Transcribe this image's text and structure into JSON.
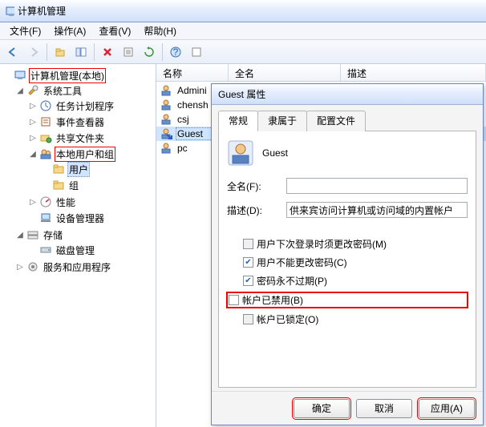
{
  "window": {
    "title": "计算机管理"
  },
  "menus": {
    "file": "文件(F)",
    "action": "操作(A)",
    "view": "查看(V)",
    "help": "帮助(H)"
  },
  "tree": {
    "root": "计算机管理(本地)",
    "sys_tools": "系统工具",
    "task_sched": "任务计划程序",
    "event_viewer": "事件查看器",
    "shared": "共享文件夹",
    "local_ug": "本地用户和组",
    "users": "用户",
    "groups": "组",
    "perf": "性能",
    "devmgr": "设备管理器",
    "storage": "存储",
    "diskmgmt": "磁盘管理",
    "services": "服务和应用程序"
  },
  "list": {
    "headers": {
      "name": "名称",
      "fullname": "全名",
      "desc": "描述"
    },
    "rows": [
      {
        "name": "Admini"
      },
      {
        "name": "chensh"
      },
      {
        "name": "csj"
      },
      {
        "name": "Guest"
      },
      {
        "name": "pc"
      }
    ]
  },
  "dialog": {
    "title": "Guest 属性",
    "tabs": {
      "general": "常规",
      "memberof": "隶属于",
      "profile": "配置文件"
    },
    "account_name": "Guest",
    "fullname_label": "全名(F):",
    "fullname_value": "",
    "desc_label": "描述(D):",
    "desc_value": "供来宾访问计算机或访问域的内置帐户",
    "chk_must_change": "用户下次登录时须更改密码(M)",
    "chk_cannot_change": "用户不能更改密码(C)",
    "chk_never_expire": "密码永不过期(P)",
    "chk_disabled": "帐户已禁用(B)",
    "chk_locked": "帐户已锁定(O)",
    "buttons": {
      "ok": "确定",
      "cancel": "取消",
      "apply": "应用(A)"
    }
  }
}
